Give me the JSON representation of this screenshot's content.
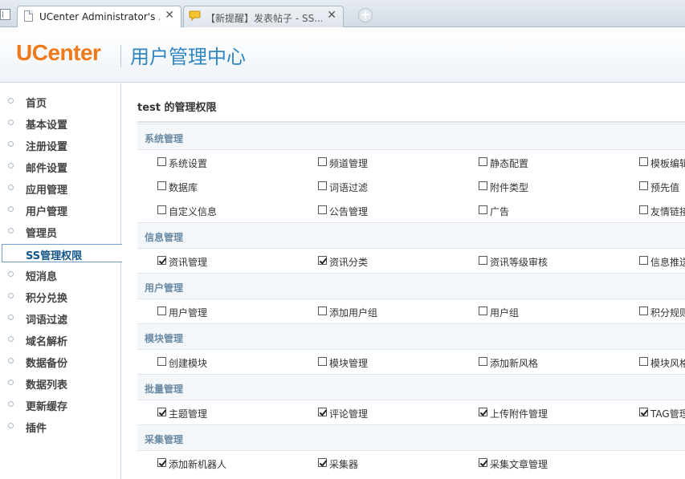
{
  "browser": {
    "tabs": [
      {
        "title": "UCenter Administrator's ...",
        "close": "✕"
      },
      {
        "title": "【新提醒】发表帖子 - SS...",
        "close": "✕"
      }
    ],
    "new_tab": "+"
  },
  "header": {
    "logo": "UCenter",
    "title": "用户管理中心"
  },
  "sidebar": {
    "items": [
      {
        "label": "首页"
      },
      {
        "label": "基本设置"
      },
      {
        "label": "注册设置"
      },
      {
        "label": "邮件设置"
      },
      {
        "label": "应用管理"
      },
      {
        "label": "用户管理"
      },
      {
        "label": "管理员"
      },
      {
        "label": "SS管理权限"
      },
      {
        "label": "短消息"
      },
      {
        "label": "积分兑换"
      },
      {
        "label": "词语过滤"
      },
      {
        "label": "域名解析"
      },
      {
        "label": "数据备份"
      },
      {
        "label": "数据列表"
      },
      {
        "label": "更新缓存"
      },
      {
        "label": "插件"
      }
    ],
    "active_index": 7
  },
  "main": {
    "title": "test 的管理权限",
    "sections": [
      {
        "label": "系统管理",
        "rows": [
          [
            {
              "label": "系统设置",
              "checked": false
            },
            {
              "label": "频道管理",
              "checked": false
            },
            {
              "label": "静态配置",
              "checked": false
            },
            {
              "label": "模板编辑",
              "checked": false
            }
          ],
          [
            {
              "label": "数据库",
              "checked": false
            },
            {
              "label": "词语过滤",
              "checked": false
            },
            {
              "label": "附件类型",
              "checked": false
            },
            {
              "label": "预先值",
              "checked": false
            }
          ],
          [
            {
              "label": "自定义信息",
              "checked": false
            },
            {
              "label": "公告管理",
              "checked": false
            },
            {
              "label": "广告",
              "checked": false
            },
            {
              "label": "友情链接",
              "checked": false
            }
          ]
        ]
      },
      {
        "label": "信息管理",
        "rows": [
          [
            {
              "label": "资讯管理",
              "checked": true
            },
            {
              "label": "资讯分类",
              "checked": true
            },
            {
              "label": "资讯等级审核",
              "checked": false
            },
            {
              "label": "信息推送",
              "checked": false
            }
          ]
        ]
      },
      {
        "label": "用户管理",
        "rows": [
          [
            {
              "label": "用户管理",
              "checked": false
            },
            {
              "label": "添加用户组",
              "checked": false
            },
            {
              "label": "用户组",
              "checked": false
            },
            {
              "label": "积分规则",
              "checked": false
            }
          ]
        ]
      },
      {
        "label": "模块管理",
        "rows": [
          [
            {
              "label": "创建模块",
              "checked": false
            },
            {
              "label": "模块管理",
              "checked": false
            },
            {
              "label": "添加新风格",
              "checked": false
            },
            {
              "label": "模块风格",
              "checked": false
            }
          ]
        ]
      },
      {
        "label": "批量管理",
        "rows": [
          [
            {
              "label": "主题管理",
              "checked": true
            },
            {
              "label": "评论管理",
              "checked": true
            },
            {
              "label": "上传附件管理",
              "checked": true
            },
            {
              "label": "TAG管理",
              "checked": true
            }
          ]
        ]
      },
      {
        "label": "采集管理",
        "rows": [
          [
            {
              "label": "添加新机器人",
              "checked": true
            },
            {
              "label": "采集器",
              "checked": true
            },
            {
              "label": "采集文章管理",
              "checked": true
            }
          ]
        ]
      }
    ]
  }
}
